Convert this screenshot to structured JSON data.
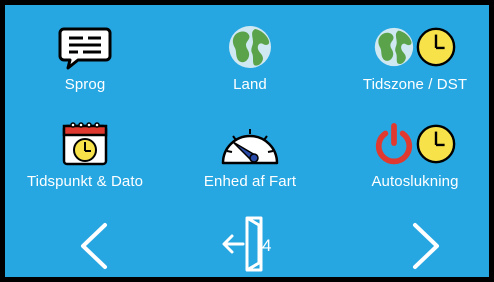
{
  "menu": {
    "items": [
      {
        "label": "Sprog",
        "icons": [
          "message-icon"
        ]
      },
      {
        "label": "Land",
        "icons": [
          "globe-icon"
        ]
      },
      {
        "label": "Tidszone / DST",
        "icons": [
          "globe-icon",
          "clock-icon"
        ]
      },
      {
        "label": "Tidspunkt & Dato",
        "icons": [
          "calendar-clock-icon"
        ]
      },
      {
        "label": "Enhed af Fart",
        "icons": [
          "speedometer-icon"
        ]
      },
      {
        "label": "Autoslukning",
        "icons": [
          "power-icon",
          "clock-icon"
        ]
      }
    ]
  },
  "nav": {
    "exit_number": "4"
  },
  "colors": {
    "background": "#27a7e2",
    "text": "#ffffff",
    "clock": "#f7e24a",
    "power": "#e03a30",
    "globe_water": "#cfe8f2",
    "globe_land": "#5aa34a"
  }
}
